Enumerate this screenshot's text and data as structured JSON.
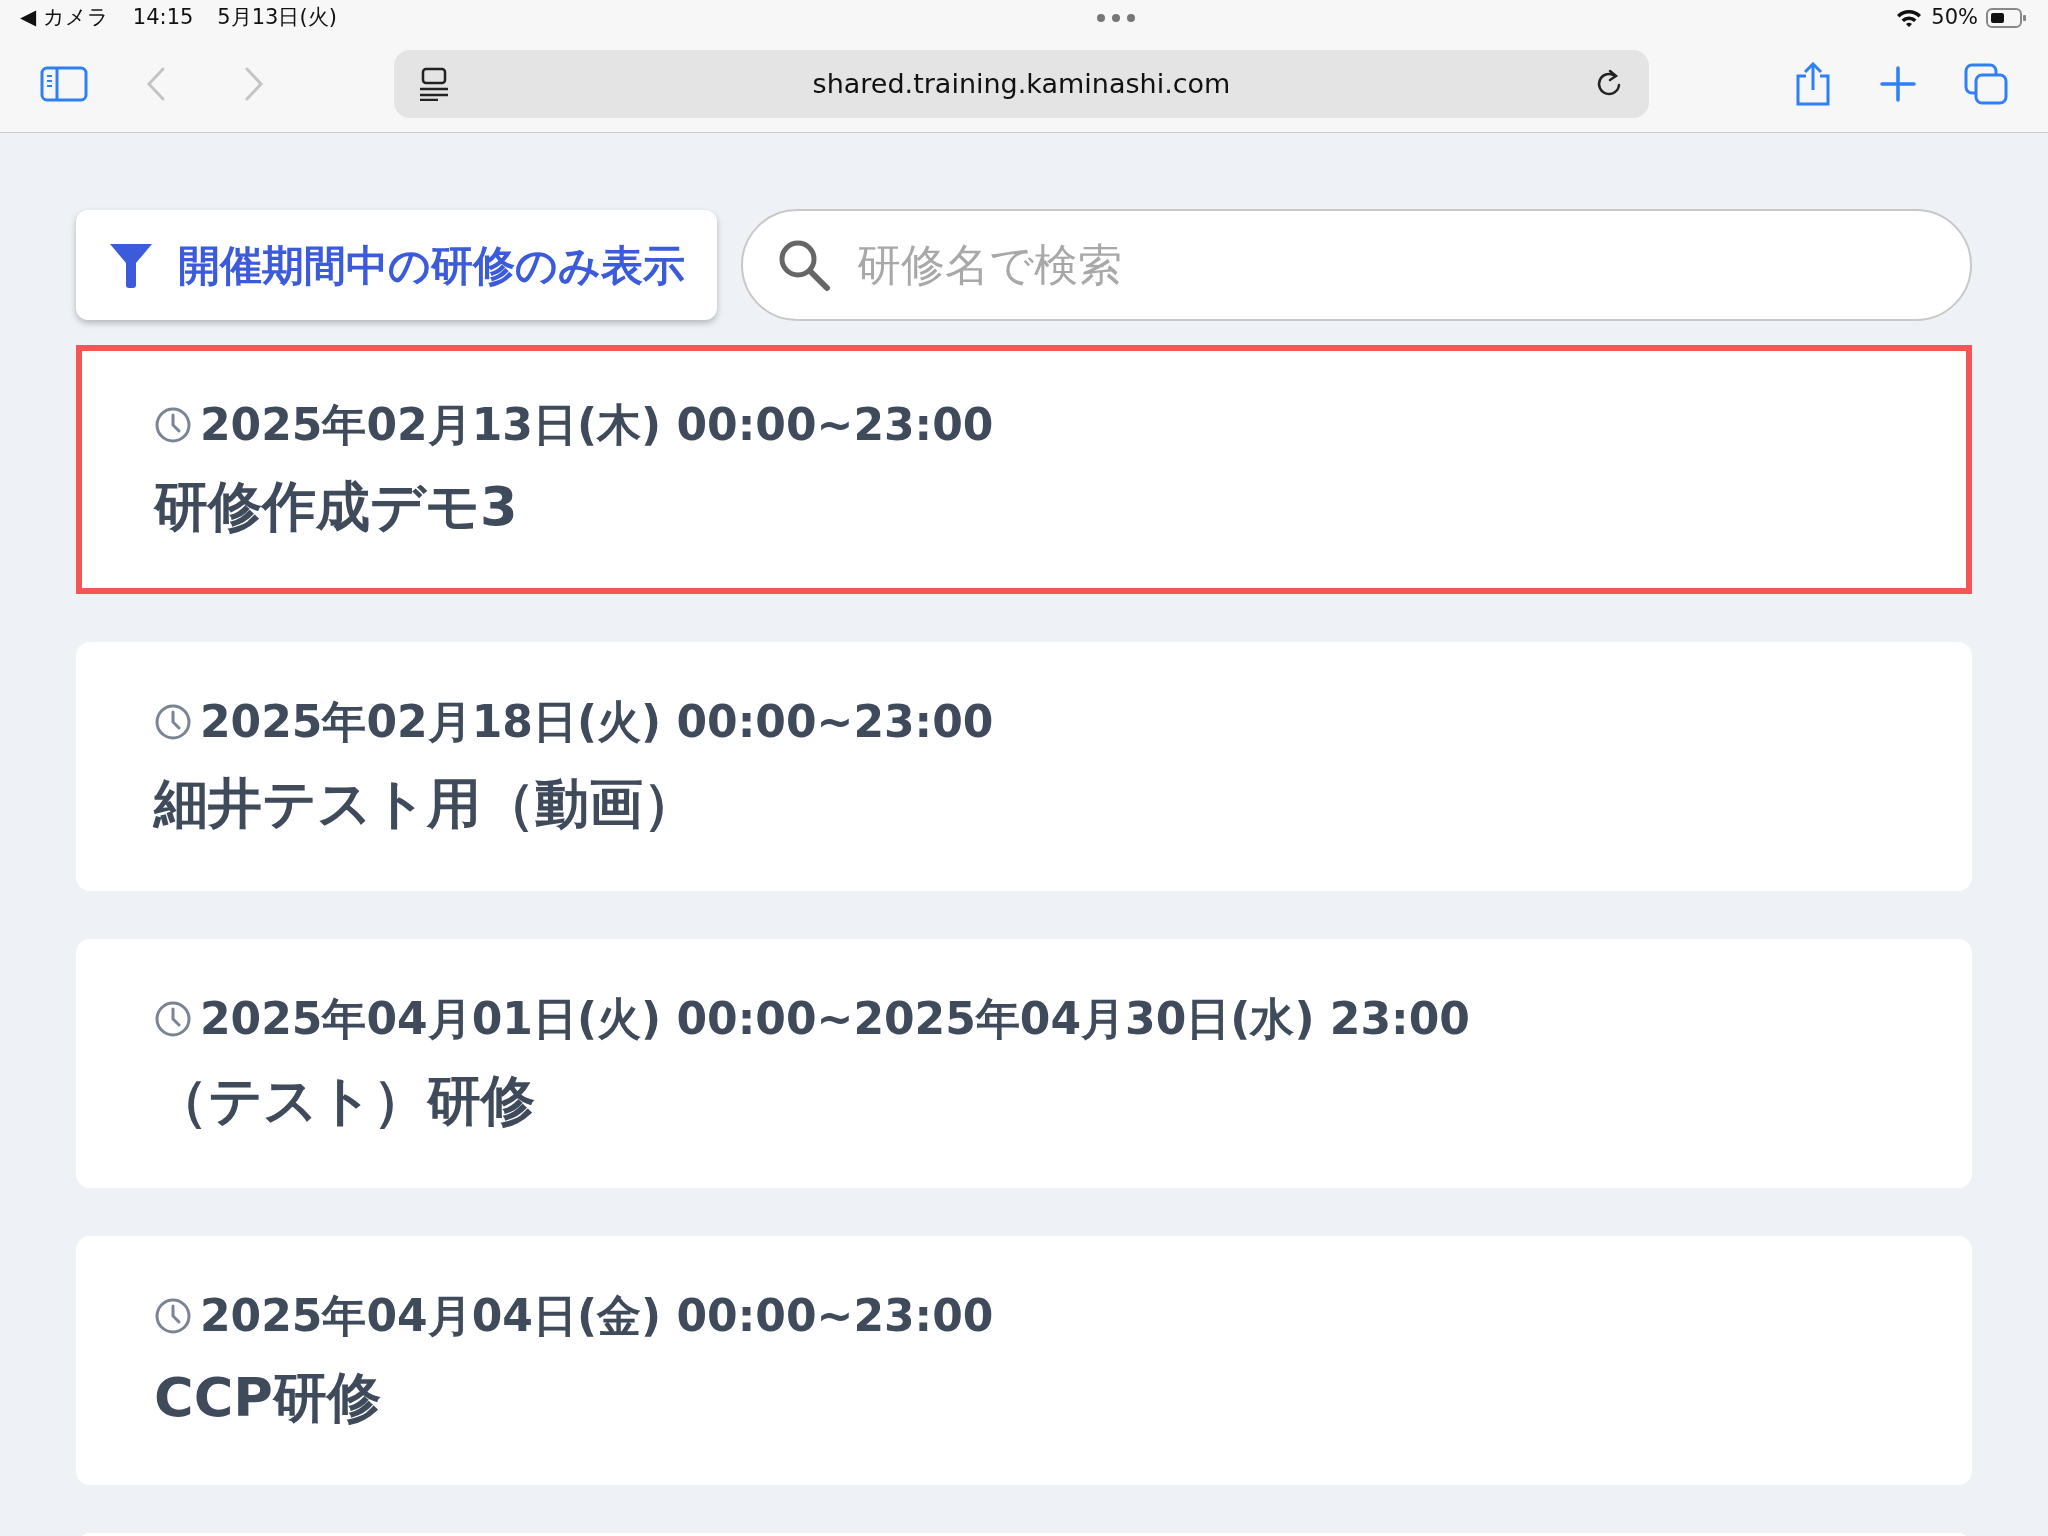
{
  "status_bar": {
    "back_app": "◀ カメラ",
    "time": "14:15",
    "date": "5月13日(火)",
    "battery_text": "50%"
  },
  "browser": {
    "url": "shared.training.kaminashi.com",
    "back_enabled": false,
    "forward_enabled": false
  },
  "filter_button": {
    "label": "開催期間中の研修のみ表示"
  },
  "search": {
    "placeholder": "研修名で検索"
  },
  "trainings": [
    {
      "schedule": "2025年02月13日(木) 00:00~23:00",
      "title": "研修作成デモ3",
      "highlighted": true
    },
    {
      "schedule": "2025年02月18日(火) 00:00~23:00",
      "title": "細井テスト用（動画）",
      "highlighted": false
    },
    {
      "schedule": "2025年04月01日(火) 00:00~2025年04月30日(水) 23:00",
      "title": "（テスト）研修",
      "highlighted": false
    },
    {
      "schedule": "2025年04月04日(金) 00:00~23:00",
      "title": "CCP研修",
      "highlighted": false
    }
  ]
}
